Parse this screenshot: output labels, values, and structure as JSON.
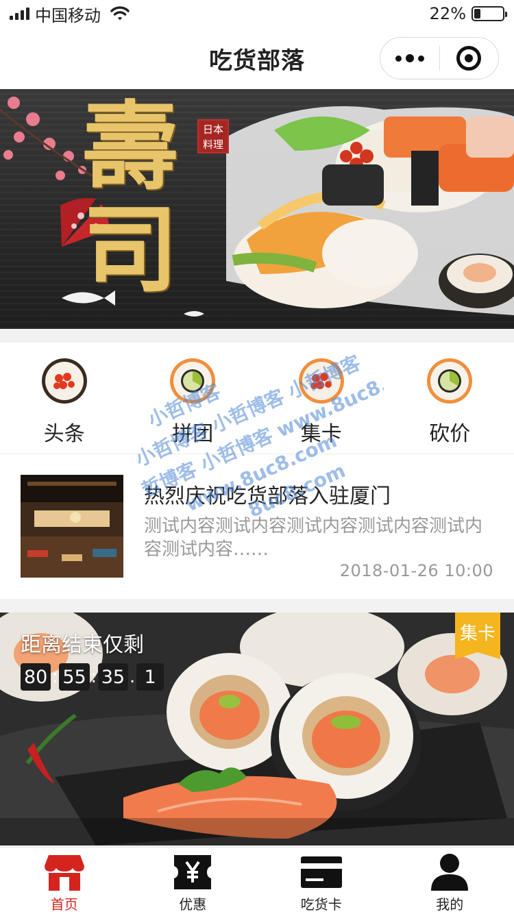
{
  "status_bar": {
    "carrier": "中国移动",
    "battery_percent_label": "22%",
    "battery_level": 0.22
  },
  "nav": {
    "title": "吃货部落",
    "more_icon": "more-dots-icon",
    "close_icon": "target-close-icon"
  },
  "banner": {
    "title": "壽司",
    "seal": "日本料理"
  },
  "grid": {
    "items": [
      {
        "label": "头条",
        "icon": "roe-sushi-icon"
      },
      {
        "label": "拼团",
        "icon": "cucumber-roll-icon"
      },
      {
        "label": "集卡",
        "icon": "roe-sushi-icon"
      },
      {
        "label": "砍价",
        "icon": "cucumber-roll-icon"
      }
    ]
  },
  "news": {
    "title": "热烈庆祝吃货部落入驻厦门",
    "desc": "测试内容测试内容测试内容测试内容测试内容测试内容……",
    "date": "2018-01-26  10:00"
  },
  "promo": {
    "title": "距离结束仅剩",
    "countdown": {
      "d": "80",
      "h": "55",
      "m": "35",
      "s": "1",
      "sep1": ":",
      "sep2": ":",
      "sep3": "."
    },
    "badge": "集卡"
  },
  "watermark": {
    "lines": [
      "小哲博客",
      "小哲博客 小哲博客 小哲博客",
      "哲博客 小哲博客 www.8uc8.com",
      "www.8uc8.com",
      "8uc8.com"
    ]
  },
  "tabbar": {
    "items": [
      {
        "label": "首页",
        "icon": "shop-icon",
        "active": true
      },
      {
        "label": "优惠",
        "icon": "yen-ticket-icon",
        "active": false
      },
      {
        "label": "吃货卡",
        "icon": "card-icon",
        "active": false
      },
      {
        "label": "我的",
        "icon": "user-icon",
        "active": false
      }
    ]
  },
  "colors": {
    "accent": "#d5241f",
    "badge": "#f4b51f",
    "banner_gold": "#e8c46a"
  }
}
